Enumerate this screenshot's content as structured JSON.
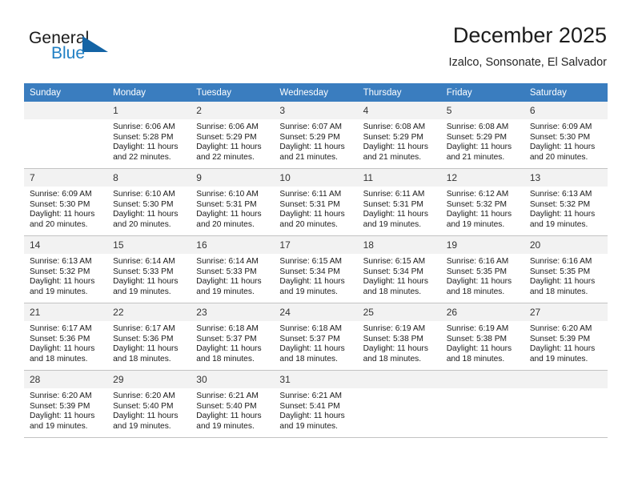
{
  "brand": {
    "name_part1": "General",
    "name_part2": "Blue",
    "triangle_icon": "triangle-icon"
  },
  "header": {
    "title": "December 2025",
    "subtitle": "Izalco, Sonsonate, El Salvador"
  },
  "calendar": {
    "weekday_headers": [
      "Sunday",
      "Monday",
      "Tuesday",
      "Wednesday",
      "Thursday",
      "Friday",
      "Saturday"
    ],
    "accent_color": "#3a7dbf",
    "daynum_bg": "#f2f2f2",
    "weeks": [
      [
        {
          "day": "",
          "empty": true,
          "sunrise": "",
          "sunset": "",
          "daylight_line1": "",
          "daylight_line2": ""
        },
        {
          "day": "1",
          "sunrise": "Sunrise: 6:06 AM",
          "sunset": "Sunset: 5:28 PM",
          "daylight_line1": "Daylight: 11 hours",
          "daylight_line2": "and 22 minutes."
        },
        {
          "day": "2",
          "sunrise": "Sunrise: 6:06 AM",
          "sunset": "Sunset: 5:29 PM",
          "daylight_line1": "Daylight: 11 hours",
          "daylight_line2": "and 22 minutes."
        },
        {
          "day": "3",
          "sunrise": "Sunrise: 6:07 AM",
          "sunset": "Sunset: 5:29 PM",
          "daylight_line1": "Daylight: 11 hours",
          "daylight_line2": "and 21 minutes."
        },
        {
          "day": "4",
          "sunrise": "Sunrise: 6:08 AM",
          "sunset": "Sunset: 5:29 PM",
          "daylight_line1": "Daylight: 11 hours",
          "daylight_line2": "and 21 minutes."
        },
        {
          "day": "5",
          "sunrise": "Sunrise: 6:08 AM",
          "sunset": "Sunset: 5:29 PM",
          "daylight_line1": "Daylight: 11 hours",
          "daylight_line2": "and 21 minutes."
        },
        {
          "day": "6",
          "sunrise": "Sunrise: 6:09 AM",
          "sunset": "Sunset: 5:30 PM",
          "daylight_line1": "Daylight: 11 hours",
          "daylight_line2": "and 20 minutes."
        }
      ],
      [
        {
          "day": "7",
          "sunrise": "Sunrise: 6:09 AM",
          "sunset": "Sunset: 5:30 PM",
          "daylight_line1": "Daylight: 11 hours",
          "daylight_line2": "and 20 minutes."
        },
        {
          "day": "8",
          "sunrise": "Sunrise: 6:10 AM",
          "sunset": "Sunset: 5:30 PM",
          "daylight_line1": "Daylight: 11 hours",
          "daylight_line2": "and 20 minutes."
        },
        {
          "day": "9",
          "sunrise": "Sunrise: 6:10 AM",
          "sunset": "Sunset: 5:31 PM",
          "daylight_line1": "Daylight: 11 hours",
          "daylight_line2": "and 20 minutes."
        },
        {
          "day": "10",
          "sunrise": "Sunrise: 6:11 AM",
          "sunset": "Sunset: 5:31 PM",
          "daylight_line1": "Daylight: 11 hours",
          "daylight_line2": "and 20 minutes."
        },
        {
          "day": "11",
          "sunrise": "Sunrise: 6:11 AM",
          "sunset": "Sunset: 5:31 PM",
          "daylight_line1": "Daylight: 11 hours",
          "daylight_line2": "and 19 minutes."
        },
        {
          "day": "12",
          "sunrise": "Sunrise: 6:12 AM",
          "sunset": "Sunset: 5:32 PM",
          "daylight_line1": "Daylight: 11 hours",
          "daylight_line2": "and 19 minutes."
        },
        {
          "day": "13",
          "sunrise": "Sunrise: 6:13 AM",
          "sunset": "Sunset: 5:32 PM",
          "daylight_line1": "Daylight: 11 hours",
          "daylight_line2": "and 19 minutes."
        }
      ],
      [
        {
          "day": "14",
          "sunrise": "Sunrise: 6:13 AM",
          "sunset": "Sunset: 5:32 PM",
          "daylight_line1": "Daylight: 11 hours",
          "daylight_line2": "and 19 minutes."
        },
        {
          "day": "15",
          "sunrise": "Sunrise: 6:14 AM",
          "sunset": "Sunset: 5:33 PM",
          "daylight_line1": "Daylight: 11 hours",
          "daylight_line2": "and 19 minutes."
        },
        {
          "day": "16",
          "sunrise": "Sunrise: 6:14 AM",
          "sunset": "Sunset: 5:33 PM",
          "daylight_line1": "Daylight: 11 hours",
          "daylight_line2": "and 19 minutes."
        },
        {
          "day": "17",
          "sunrise": "Sunrise: 6:15 AM",
          "sunset": "Sunset: 5:34 PM",
          "daylight_line1": "Daylight: 11 hours",
          "daylight_line2": "and 19 minutes."
        },
        {
          "day": "18",
          "sunrise": "Sunrise: 6:15 AM",
          "sunset": "Sunset: 5:34 PM",
          "daylight_line1": "Daylight: 11 hours",
          "daylight_line2": "and 18 minutes."
        },
        {
          "day": "19",
          "sunrise": "Sunrise: 6:16 AM",
          "sunset": "Sunset: 5:35 PM",
          "daylight_line1": "Daylight: 11 hours",
          "daylight_line2": "and 18 minutes."
        },
        {
          "day": "20",
          "sunrise": "Sunrise: 6:16 AM",
          "sunset": "Sunset: 5:35 PM",
          "daylight_line1": "Daylight: 11 hours",
          "daylight_line2": "and 18 minutes."
        }
      ],
      [
        {
          "day": "21",
          "sunrise": "Sunrise: 6:17 AM",
          "sunset": "Sunset: 5:36 PM",
          "daylight_line1": "Daylight: 11 hours",
          "daylight_line2": "and 18 minutes."
        },
        {
          "day": "22",
          "sunrise": "Sunrise: 6:17 AM",
          "sunset": "Sunset: 5:36 PM",
          "daylight_line1": "Daylight: 11 hours",
          "daylight_line2": "and 18 minutes."
        },
        {
          "day": "23",
          "sunrise": "Sunrise: 6:18 AM",
          "sunset": "Sunset: 5:37 PM",
          "daylight_line1": "Daylight: 11 hours",
          "daylight_line2": "and 18 minutes."
        },
        {
          "day": "24",
          "sunrise": "Sunrise: 6:18 AM",
          "sunset": "Sunset: 5:37 PM",
          "daylight_line1": "Daylight: 11 hours",
          "daylight_line2": "and 18 minutes."
        },
        {
          "day": "25",
          "sunrise": "Sunrise: 6:19 AM",
          "sunset": "Sunset: 5:38 PM",
          "daylight_line1": "Daylight: 11 hours",
          "daylight_line2": "and 18 minutes."
        },
        {
          "day": "26",
          "sunrise": "Sunrise: 6:19 AM",
          "sunset": "Sunset: 5:38 PM",
          "daylight_line1": "Daylight: 11 hours",
          "daylight_line2": "and 18 minutes."
        },
        {
          "day": "27",
          "sunrise": "Sunrise: 6:20 AM",
          "sunset": "Sunset: 5:39 PM",
          "daylight_line1": "Daylight: 11 hours",
          "daylight_line2": "and 19 minutes."
        }
      ],
      [
        {
          "day": "28",
          "sunrise": "Sunrise: 6:20 AM",
          "sunset": "Sunset: 5:39 PM",
          "daylight_line1": "Daylight: 11 hours",
          "daylight_line2": "and 19 minutes."
        },
        {
          "day": "29",
          "sunrise": "Sunrise: 6:20 AM",
          "sunset": "Sunset: 5:40 PM",
          "daylight_line1": "Daylight: 11 hours",
          "daylight_line2": "and 19 minutes."
        },
        {
          "day": "30",
          "sunrise": "Sunrise: 6:21 AM",
          "sunset": "Sunset: 5:40 PM",
          "daylight_line1": "Daylight: 11 hours",
          "daylight_line2": "and 19 minutes."
        },
        {
          "day": "31",
          "sunrise": "Sunrise: 6:21 AM",
          "sunset": "Sunset: 5:41 PM",
          "daylight_line1": "Daylight: 11 hours",
          "daylight_line2": "and 19 minutes."
        },
        {
          "day": "",
          "empty": true,
          "sunrise": "",
          "sunset": "",
          "daylight_line1": "",
          "daylight_line2": ""
        },
        {
          "day": "",
          "empty": true,
          "sunrise": "",
          "sunset": "",
          "daylight_line1": "",
          "daylight_line2": ""
        },
        {
          "day": "",
          "empty": true,
          "sunrise": "",
          "sunset": "",
          "daylight_line1": "",
          "daylight_line2": ""
        }
      ]
    ]
  }
}
